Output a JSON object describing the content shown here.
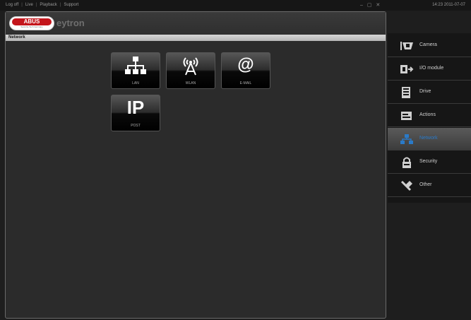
{
  "topbar": {
    "nav": [
      "Log off",
      "Live",
      "Playback",
      "Support"
    ],
    "window_controls": "– ▢ ✕",
    "clock": "14:23 2011-07-07"
  },
  "header": {
    "logo_text": "ABUS",
    "logo_tag": "Security-Tech Germany",
    "brand": "eytron"
  },
  "section": {
    "title": "Network"
  },
  "tiles": [
    {
      "label": "LAN"
    },
    {
      "label": "WLAN"
    },
    {
      "label": "E-MAIL"
    },
    {
      "label": "POST",
      "glyph": "IP"
    }
  ],
  "tile_glyphs": {
    "email": "@",
    "wlan": "((A))"
  },
  "sidebar": {
    "items": [
      {
        "label": "Camera",
        "icon": "camera-icon"
      },
      {
        "label": "I/O module",
        "icon": "io-module-icon"
      },
      {
        "label": "Drive",
        "icon": "drive-icon"
      },
      {
        "label": "Actions",
        "icon": "actions-icon"
      },
      {
        "label": "Network",
        "icon": "network-icon",
        "active": true
      },
      {
        "label": "Security",
        "icon": "lock-icon"
      },
      {
        "label": "Other",
        "icon": "tools-icon"
      }
    ]
  },
  "colors": {
    "accent": "#2a7ac8",
    "brand_red": "#c4161c"
  }
}
